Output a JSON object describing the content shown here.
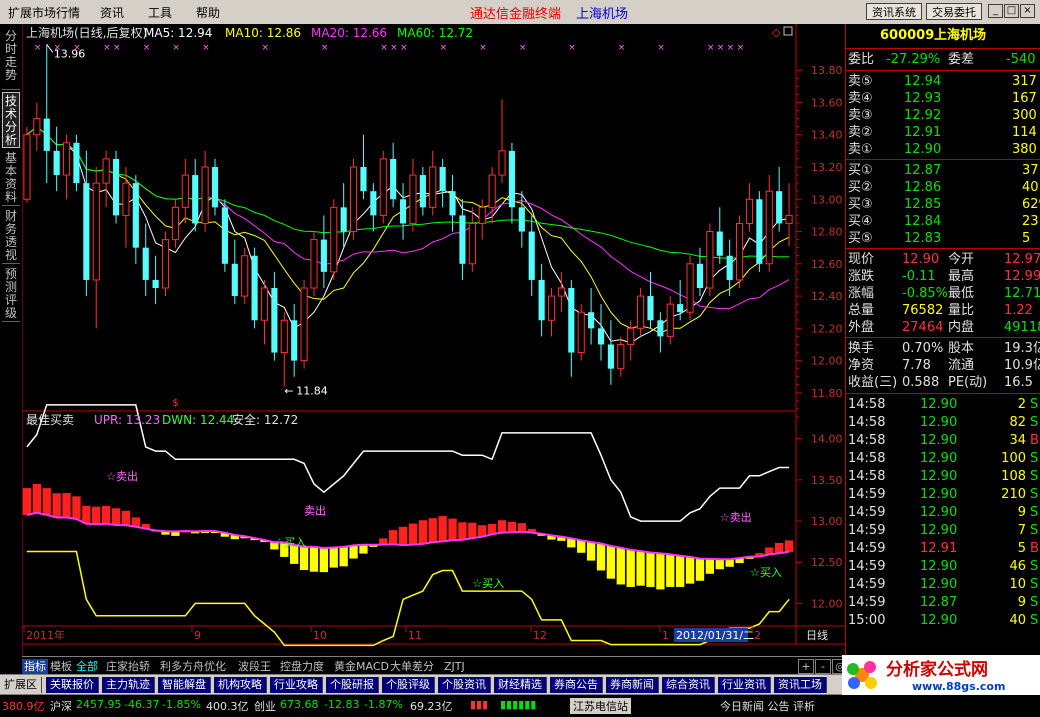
{
  "menubar": {
    "items": [
      "扩展市场行情",
      "资讯",
      "工具",
      "帮助"
    ],
    "app_title": "通达信金融终端",
    "stock_title": "上海机场",
    "buttons": [
      "资讯系统",
      "交易委托"
    ],
    "window_controls": [
      "minimize-icon",
      "restore-icon",
      "close-icon"
    ]
  },
  "side_tabs": [
    {
      "label": "分时走势",
      "active": false
    },
    {
      "label": "技术分析",
      "active": true
    },
    {
      "label": "基本资料",
      "active": false
    },
    {
      "label": "财务透视",
      "active": false
    },
    {
      "label": "预测评级",
      "active": false
    }
  ],
  "main_chart": {
    "title": "上海机场(日线,后复权)",
    "ma": [
      {
        "name": "MA5",
        "value": "12.94",
        "color": "#ffffff"
      },
      {
        "name": "MA10",
        "value": "12.86",
        "color": "#ffff00"
      },
      {
        "name": "MA20",
        "value": "12.66",
        "color": "#ff33ff"
      },
      {
        "name": "MA60",
        "value": "12.72",
        "color": "#00ff00"
      }
    ],
    "high_label": "13.96",
    "low_label": "11.84",
    "y_ticks": [
      "13.80",
      "13.60",
      "13.40",
      "13.20",
      "13.00",
      "12.80",
      "12.60",
      "12.40",
      "12.20",
      "12.00",
      "11.80"
    ]
  },
  "indicator": {
    "name": "最佳买卖",
    "upr_label": "UPR: 13.23",
    "dwn_label": "DWN: 12.44",
    "safe_label": "安全: 12.72",
    "y_ticks": [
      "14.00",
      "13.50",
      "13.00",
      "12.50",
      "12.00"
    ],
    "annotations": [
      {
        "text": "☆卖出",
        "color": "#ff66ff"
      },
      {
        "text": "卖出",
        "color": "#ff66ff"
      },
      {
        "text": "☆卖出",
        "color": "#ff66ff"
      },
      {
        "text": "☆买入",
        "color": "#33ff33"
      },
      {
        "text": "☆买入",
        "color": "#33ff33"
      },
      {
        "text": "☆买入",
        "color": "#33ff33"
      }
    ]
  },
  "x_axis": {
    "labels": [
      "2011年",
      "9",
      "10",
      "11",
      "12",
      "1",
      "2012/01/31/二",
      "2"
    ],
    "period": "日线"
  },
  "quote": {
    "code": "600009",
    "name": "上海机场",
    "weibi_label": "委比",
    "weibi": "-27.29%",
    "weicha_label": "委差",
    "weicha": "-540",
    "asks": [
      {
        "label": "卖⑤",
        "price": "12.94",
        "vol": "317"
      },
      {
        "label": "卖④",
        "price": "12.93",
        "vol": "167"
      },
      {
        "label": "卖③",
        "price": "12.92",
        "vol": "300"
      },
      {
        "label": "卖②",
        "price": "12.91",
        "vol": "114"
      },
      {
        "label": "卖①",
        "price": "12.90",
        "vol": "380"
      }
    ],
    "bids": [
      {
        "label": "买①",
        "price": "12.87",
        "vol": "37"
      },
      {
        "label": "买②",
        "price": "12.86",
        "vol": "40"
      },
      {
        "label": "买③",
        "price": "12.85",
        "vol": "629"
      },
      {
        "label": "买④",
        "price": "12.84",
        "vol": "23"
      },
      {
        "label": "买⑤",
        "price": "12.83",
        "vol": "5"
      }
    ],
    "stats": [
      {
        "l1": "现价",
        "v1": "12.90",
        "c1": "#ff3333",
        "l2": "今开",
        "v2": "12.97",
        "c2": "#ff3333"
      },
      {
        "l1": "涨跌",
        "v1": "-0.11",
        "c1": "#00e000",
        "l2": "最高",
        "v2": "12.99",
        "c2": "#ff3333"
      },
      {
        "l1": "涨幅",
        "v1": "-0.85%",
        "c1": "#00e000",
        "l2": "最低",
        "v2": "12.71",
        "c2": "#00e000"
      },
      {
        "l1": "总量",
        "v1": "76582",
        "c1": "#ffff00",
        "l2": "量比",
        "v2": "1.22",
        "c2": "#ff3333"
      },
      {
        "l1": "外盘",
        "v1": "27464",
        "c1": "#ff3333",
        "l2": "内盘",
        "v2": "49118",
        "c2": "#00e000"
      }
    ],
    "stats2": [
      {
        "l1": "换手",
        "v1": "0.70%",
        "l2": "股本",
        "v2": "19.3亿"
      },
      {
        "l1": "净资",
        "v1": "7.78",
        "l2": "流通",
        "v2": "10.9亿"
      },
      {
        "l1": "收益(三)",
        "v1": "0.588",
        "l2": "PE(动)",
        "v2": "16.5"
      }
    ],
    "ticks": [
      {
        "time": "14:58",
        "price": "12.90",
        "vol": "2",
        "dir": "S"
      },
      {
        "time": "14:58",
        "price": "12.90",
        "vol": "82",
        "dir": "S"
      },
      {
        "time": "14:58",
        "price": "12.90",
        "vol": "34",
        "dir": "B"
      },
      {
        "time": "14:58",
        "price": "12.90",
        "vol": "100",
        "dir": "S"
      },
      {
        "time": "14:58",
        "price": "12.90",
        "vol": "108",
        "dir": "S"
      },
      {
        "time": "14:59",
        "price": "12.90",
        "vol": "210",
        "dir": "S"
      },
      {
        "time": "14:59",
        "price": "12.90",
        "vol": "9",
        "dir": "S"
      },
      {
        "time": "14:59",
        "price": "12.90",
        "vol": "7",
        "dir": "S"
      },
      {
        "time": "14:59",
        "price": "12.91",
        "vol": "5",
        "dir": "B"
      },
      {
        "time": "14:59",
        "price": "12.90",
        "vol": "46",
        "dir": "S"
      },
      {
        "time": "14:59",
        "price": "12.90",
        "vol": "10",
        "dir": "S"
      },
      {
        "time": "14:59",
        "price": "12.87",
        "vol": "9",
        "dir": "S"
      },
      {
        "time": "15:00",
        "price": "12.90",
        "vol": "40",
        "dir": "S"
      }
    ]
  },
  "indicator_tabs": [
    "指标",
    "模板",
    "全部",
    "庄家抬轿",
    "利多方舟优化",
    "波段王",
    "控盘力度",
    "黄金MACD",
    "大单差分",
    "ZJTJ"
  ],
  "scroll_buttons": [
    "+",
    "-",
    "◎"
  ],
  "bottom_tabs": [
    "扩展区",
    "关联报价",
    "主力轨迹",
    "智能解盘",
    "机构攻略",
    "行业攻略",
    "个股研报",
    "个股评级",
    "个股资讯",
    "财经精选",
    "券商公告",
    "券商新闻",
    "综合资讯",
    "行业资讯",
    "资讯工场"
  ],
  "status": {
    "shanghai": "380.9亿",
    "hushen_label": "沪深",
    "hushen_val": "2457.95",
    "hushen_chg": "-46.37",
    "hushen_pct": "-1.85%",
    "hushen_amt": "400.3亿",
    "chuangye_label": "创业",
    "chuangye_val": "673.68",
    "chuangye_chg": "-12.83",
    "chuangye_pct": "-1.87%",
    "chuangye_amt": "69.23亿",
    "site": "江苏电信站",
    "news": "今日新闻 公告 评析"
  },
  "logo": {
    "title": "分析家公式网",
    "url": "www.88gs.com"
  },
  "chart_data": {
    "type": "candlestick",
    "title": "上海机场(日线,后复权)",
    "ylim": [
      11.7,
      13.95
    ],
    "ohlc": [
      [
        13.0,
        13.45,
        12.98,
        13.4
      ],
      [
        13.4,
        13.6,
        13.3,
        13.5
      ],
      [
        13.5,
        13.96,
        13.1,
        13.3
      ],
      [
        13.3,
        13.45,
        13.05,
        13.15
      ],
      [
        13.15,
        13.4,
        13.0,
        13.35
      ],
      [
        13.35,
        13.4,
        13.05,
        13.1
      ],
      [
        13.1,
        13.3,
        12.4,
        12.5
      ],
      [
        12.5,
        13.2,
        12.2,
        13.1
      ],
      [
        13.1,
        13.3,
        12.95,
        13.25
      ],
      [
        13.25,
        13.3,
        12.85,
        12.9
      ],
      [
        12.9,
        13.2,
        12.7,
        13.1
      ],
      [
        13.1,
        13.15,
        12.6,
        12.7
      ],
      [
        12.7,
        12.85,
        12.4,
        12.5
      ],
      [
        12.5,
        12.65,
        12.35,
        12.45
      ],
      [
        12.45,
        12.8,
        12.4,
        12.75
      ],
      [
        12.75,
        13.0,
        12.7,
        12.95
      ],
      [
        12.95,
        13.25,
        12.85,
        13.15
      ],
      [
        13.15,
        13.25,
        12.8,
        12.85
      ],
      [
        12.85,
        13.3,
        12.8,
        13.2
      ],
      [
        13.2,
        13.25,
        12.9,
        12.95
      ],
      [
        12.95,
        13.0,
        12.55,
        12.6
      ],
      [
        12.6,
        12.75,
        12.35,
        12.4
      ],
      [
        12.4,
        12.7,
        12.35,
        12.65
      ],
      [
        12.65,
        12.7,
        12.2,
        12.25
      ],
      [
        12.25,
        12.5,
        12.1,
        12.45
      ],
      [
        12.45,
        12.55,
        12.0,
        12.05
      ],
      [
        12.05,
        12.3,
        11.84,
        12.25
      ],
      [
        12.25,
        12.35,
        11.9,
        12.0
      ],
      [
        12.0,
        12.5,
        11.95,
        12.45
      ],
      [
        12.45,
        12.8,
        12.4,
        12.75
      ],
      [
        12.75,
        12.9,
        12.45,
        12.55
      ],
      [
        12.55,
        13.0,
        12.5,
        12.95
      ],
      [
        12.95,
        13.1,
        12.7,
        12.8
      ],
      [
        12.8,
        13.25,
        12.75,
        13.2
      ],
      [
        13.2,
        13.4,
        13.0,
        13.05
      ],
      [
        13.05,
        13.1,
        12.8,
        12.9
      ],
      [
        12.9,
        13.3,
        12.85,
        13.25
      ],
      [
        13.25,
        13.35,
        12.95,
        13.0
      ],
      [
        13.0,
        13.1,
        12.75,
        12.85
      ],
      [
        12.85,
        13.25,
        12.8,
        13.15
      ],
      [
        13.15,
        13.2,
        12.9,
        12.95
      ],
      [
        12.95,
        13.3,
        12.9,
        13.2
      ],
      [
        13.2,
        13.25,
        12.95,
        13.05
      ],
      [
        13.05,
        13.15,
        12.8,
        12.9
      ],
      [
        12.9,
        13.0,
        12.5,
        12.6
      ],
      [
        12.6,
        12.95,
        12.55,
        12.85
      ],
      [
        12.85,
        13.0,
        12.75,
        12.95
      ],
      [
        12.95,
        13.2,
        12.85,
        13.15
      ],
      [
        13.15,
        13.62,
        13.1,
        13.3
      ],
      [
        13.3,
        13.35,
        12.85,
        12.95
      ],
      [
        12.95,
        13.05,
        12.7,
        12.8
      ],
      [
        12.8,
        12.9,
        12.4,
        12.5
      ],
      [
        12.5,
        12.6,
        12.15,
        12.25
      ],
      [
        12.25,
        12.45,
        12.15,
        12.4
      ],
      [
        12.4,
        12.55,
        12.3,
        12.45
      ],
      [
        12.45,
        12.5,
        11.9,
        12.05
      ],
      [
        12.05,
        12.35,
        12.0,
        12.3
      ],
      [
        12.3,
        12.45,
        12.1,
        12.2
      ],
      [
        12.2,
        12.35,
        12.0,
        12.1
      ],
      [
        12.1,
        12.25,
        11.85,
        11.95
      ],
      [
        11.95,
        12.15,
        11.9,
        12.1
      ],
      [
        12.1,
        12.25,
        12.0,
        12.2
      ],
      [
        12.2,
        12.45,
        12.15,
        12.4
      ],
      [
        12.4,
        12.55,
        12.2,
        12.25
      ],
      [
        12.25,
        12.3,
        12.05,
        12.15
      ],
      [
        12.15,
        12.4,
        12.1,
        12.35
      ],
      [
        12.35,
        12.5,
        12.25,
        12.3
      ],
      [
        12.3,
        12.65,
        12.25,
        12.6
      ],
      [
        12.6,
        12.7,
        12.4,
        12.45
      ],
      [
        12.45,
        12.85,
        12.4,
        12.8
      ],
      [
        12.8,
        12.95,
        12.6,
        12.65
      ],
      [
        12.65,
        12.75,
        12.4,
        12.5
      ],
      [
        12.5,
        12.9,
        12.45,
        12.85
      ],
      [
        12.85,
        13.1,
        12.8,
        13.0
      ],
      [
        13.0,
        13.05,
        12.55,
        12.6
      ],
      [
        12.6,
        13.15,
        12.55,
        13.05
      ],
      [
        13.05,
        13.2,
        12.8,
        12.85
      ],
      [
        12.85,
        13.1,
        12.71,
        12.9
      ]
    ],
    "indicator_ylim": [
      11.75,
      14.3
    ]
  }
}
